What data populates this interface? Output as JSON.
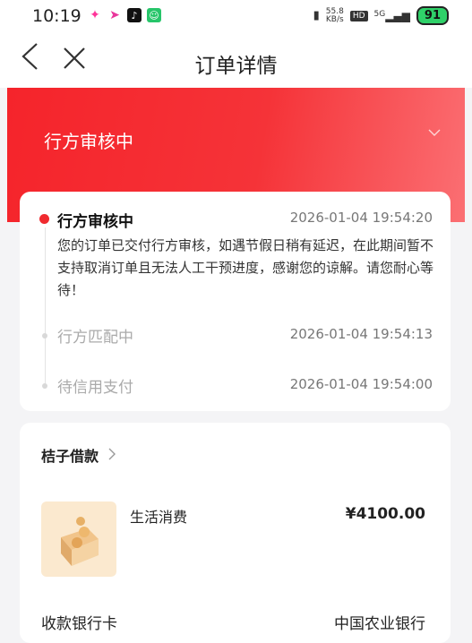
{
  "status_bar": {
    "time": "10:19",
    "net_speed_value": "55.8",
    "net_speed_unit": "KB/s",
    "hd_label": "HD",
    "network": "5G",
    "battery": "91"
  },
  "nav": {
    "title": "订单详情",
    "back_icon": "chevron-left-icon",
    "close_icon": "close-icon"
  },
  "hero": {
    "status_title": "行方审核中",
    "background_color": "#f5242b"
  },
  "timeline": {
    "steps": [
      {
        "name": "行方审核中",
        "time": "2026-01-04 19:54:20",
        "active": true,
        "description": "您的订单已交付行方审核，如遇节假日稍有延迟，在此期间暂不支持取消订单且无法人工干预进度，感谢您的谅解。请您耐心等待！"
      },
      {
        "name": "行方匹配中",
        "time": "2026-01-04 19:54:13",
        "active": false
      },
      {
        "name": "待信用支付",
        "time": "2026-01-04 19:54:00",
        "active": false
      }
    ]
  },
  "loan": {
    "provider": "桔子借款",
    "purpose": "生活消费",
    "amount": "¥4100.00",
    "bank_label": "收款银行卡",
    "bank_value": "中国农业银行"
  }
}
